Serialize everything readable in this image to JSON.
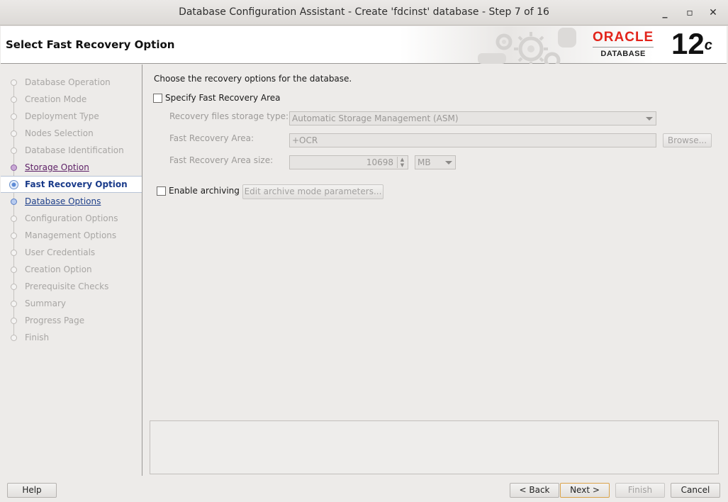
{
  "window": {
    "title": "Database Configuration Assistant - Create 'fdcinst' database - Step 7 of 16",
    "minimize_glyph": "_",
    "maximize_glyph": "▫",
    "close_glyph": "✕"
  },
  "header": {
    "page_title": "Select Fast Recovery Option",
    "brand": "ORACLE",
    "brand_sub": "DATABASE",
    "version_number": "12",
    "version_suffix": "c"
  },
  "steps": [
    {
      "label": "Database Operation",
      "state": "done"
    },
    {
      "label": "Creation Mode",
      "state": "done"
    },
    {
      "label": "Deployment Type",
      "state": "done"
    },
    {
      "label": "Nodes Selection",
      "state": "done"
    },
    {
      "label": "Database Identification",
      "state": "done"
    },
    {
      "label": "Storage Option",
      "state": "visited"
    },
    {
      "label": "Fast Recovery Option",
      "state": "current"
    },
    {
      "label": "Database Options",
      "state": "link"
    },
    {
      "label": "Configuration Options",
      "state": "pending"
    },
    {
      "label": "Management Options",
      "state": "pending"
    },
    {
      "label": "User Credentials",
      "state": "pending"
    },
    {
      "label": "Creation Option",
      "state": "pending"
    },
    {
      "label": "Prerequisite Checks",
      "state": "pending"
    },
    {
      "label": "Summary",
      "state": "pending"
    },
    {
      "label": "Progress Page",
      "state": "pending"
    },
    {
      "label": "Finish",
      "state": "pending"
    }
  ],
  "content": {
    "intro": "Choose the recovery options for the database.",
    "specify_fra_label": "Specify Fast Recovery Area",
    "specify_fra_checked": false,
    "storage_type_label": "Recovery files storage type:",
    "storage_type_value": "Automatic Storage Management (ASM)",
    "fra_label": "Fast Recovery Area:",
    "fra_value": "+OCR",
    "browse_label": "Browse...",
    "fra_size_label": "Fast Recovery Area size:",
    "fra_size_value": "10698",
    "fra_size_unit": "MB",
    "enable_archiving_label": "Enable archiving",
    "enable_archiving_checked": false,
    "edit_archive_label": "Edit archive mode parameters..."
  },
  "footer": {
    "help_label": "Help",
    "back_label": "< Back",
    "next_label": "Next >",
    "finish_label": "Finish",
    "cancel_label": "Cancel"
  },
  "colors": {
    "accent_current": "#1a3b8a",
    "visited_link": "#5d1f66",
    "oracle_red": "#e2231a"
  }
}
